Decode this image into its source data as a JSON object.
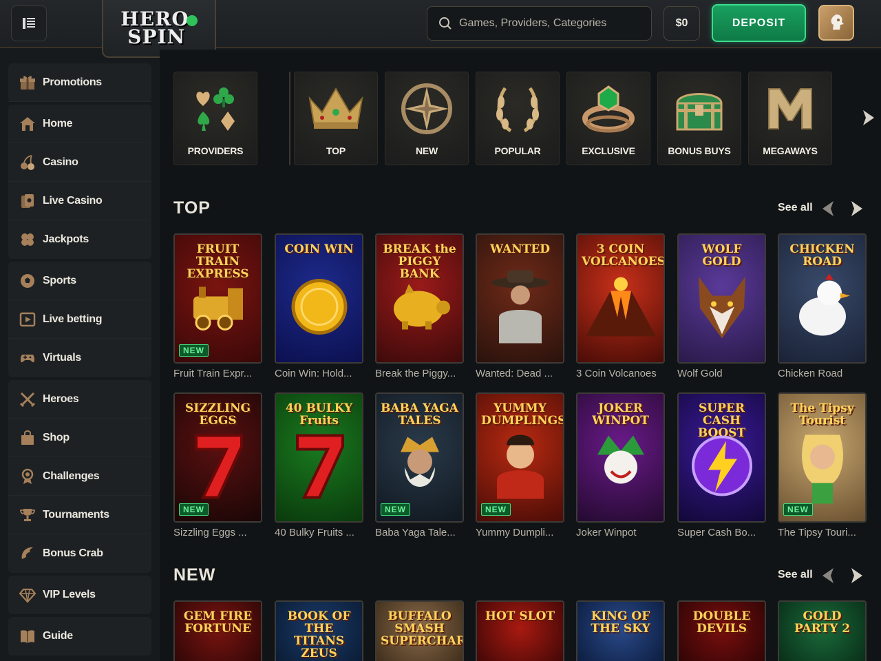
{
  "brand": {
    "logo_line1": "HERO",
    "logo_line2": "SPIN"
  },
  "header": {
    "search_placeholder": "Games, Providers, Categories",
    "balance": "$0",
    "deposit_label": "DEPOSIT"
  },
  "sidebar": {
    "groups": [
      [
        {
          "label": "Promotions",
          "icon": "gift-icon"
        }
      ],
      [
        {
          "label": "Home",
          "icon": "home-icon"
        },
        {
          "label": "Casino",
          "icon": "cherries-icon"
        },
        {
          "label": "Live Casino",
          "icon": "cards-icon"
        },
        {
          "label": "Jackpots",
          "icon": "clover-icon"
        }
      ],
      [
        {
          "label": "Sports",
          "icon": "soccer-ball-icon"
        },
        {
          "label": "Live betting",
          "icon": "live-play-icon"
        },
        {
          "label": "Virtuals",
          "icon": "gamepad-icon"
        }
      ],
      [
        {
          "label": "Heroes",
          "icon": "swords-icon"
        },
        {
          "label": "Shop",
          "icon": "bag-icon"
        },
        {
          "label": "Challenges",
          "icon": "medal-icon"
        },
        {
          "label": "Tournaments",
          "icon": "trophy-icon"
        },
        {
          "label": "Bonus Crab",
          "icon": "crab-claw-icon"
        }
      ],
      [
        {
          "label": "VIP Levels",
          "icon": "diamond-icon"
        }
      ],
      [
        {
          "label": "Guide",
          "icon": "book-icon"
        }
      ]
    ]
  },
  "categories": [
    {
      "label": "PROVIDERS",
      "icon": "card-suits-icon"
    },
    {
      "label": "TOP",
      "icon": "crown-icon"
    },
    {
      "label": "NEW",
      "icon": "compass-star-icon"
    },
    {
      "label": "POPULAR",
      "icon": "laurel-wreath-icon"
    },
    {
      "label": "EXCLUSIVE",
      "icon": "emerald-ring-icon"
    },
    {
      "label": "BONUS BUYS",
      "icon": "treasure-chest-icon"
    },
    {
      "label": "MEGAWAYS",
      "icon": "megaways-m-icon"
    }
  ],
  "sections": {
    "top": {
      "title": "TOP",
      "see_all": "See all",
      "rows": [
        [
          {
            "name": "Fruit Train Expr...",
            "art_title": "FRUIT TRAIN EXPRESS",
            "new": "NEW",
            "colors": [
              "#7a1410",
              "#3a0808"
            ],
            "emblem": "locomotive-icon"
          },
          {
            "name": "Coin Win: Hold...",
            "art_title": "COIN WIN",
            "new": "",
            "colors": [
              "#1d2a8a",
              "#0c1050"
            ],
            "emblem": "gold-coin-icon"
          },
          {
            "name": "Break the Piggy...",
            "art_title": "BREAK the PIGGY BANK",
            "new": "",
            "colors": [
              "#9a1a1a",
              "#3e0a0a"
            ],
            "emblem": "piggy-bank-icon"
          },
          {
            "name": "Wanted: Dead ...",
            "art_title": "WANTED",
            "new": "",
            "colors": [
              "#6e2a18",
              "#2a120c"
            ],
            "emblem": "cowboy-icon"
          },
          {
            "name": "3 Coin Volcanoes",
            "art_title": "3 COIN VOLCANOES",
            "new": "",
            "colors": [
              "#c8301a",
              "#4a0c06"
            ],
            "emblem": "volcano-icon"
          },
          {
            "name": "Wolf Gold",
            "art_title": "WOLF GOLD",
            "new": "",
            "colors": [
              "#5a3a9a",
              "#2a1a4a"
            ],
            "emblem": "wolf-icon"
          },
          {
            "name": "Chicken Road",
            "art_title": "CHICKEN ROAD",
            "new": "",
            "colors": [
              "#384a6a",
              "#1a2236"
            ],
            "emblem": "chicken-icon"
          }
        ],
        [
          {
            "name": "Sizzling Eggs ...",
            "art_title": "SIZZLING EGGS",
            "new": "NEW",
            "colors": [
              "#5a1010",
              "#1a0606"
            ],
            "emblem": "lucky-seven-icon"
          },
          {
            "name": "40 Bulky Fruits ...",
            "art_title": "40 BULKY Fruits",
            "new": "",
            "colors": [
              "#1a7a20",
              "#0a3a0c"
            ],
            "emblem": "lucky-seven-icon"
          },
          {
            "name": "Baba Yaga Tale...",
            "art_title": "BABA YAGA TALES",
            "new": "NEW",
            "colors": [
              "#2a3a4a",
              "#101820"
            ],
            "emblem": "old-king-icon"
          },
          {
            "name": "Yummy Dumpli...",
            "art_title": "YUMMY DUMPLINGS",
            "new": "NEW",
            "colors": [
              "#b82a12",
              "#4a0c06"
            ],
            "emblem": "chef-icon"
          },
          {
            "name": "Joker Winpot",
            "art_title": "JOKER WINPOT",
            "new": "",
            "colors": [
              "#6a1a8a",
              "#240a30"
            ],
            "emblem": "joker-icon"
          },
          {
            "name": "Super Cash Bo...",
            "art_title": "SUPER CASH BOOST",
            "new": "",
            "colors": [
              "#3a1a9a",
              "#120838"
            ],
            "emblem": "lightning-icon"
          },
          {
            "name": "The Tipsy Touri...",
            "art_title": "The Tipsy Tourist",
            "new": "NEW",
            "colors": [
              "#c8a870",
              "#6a5030"
            ],
            "emblem": "tourist-icon"
          }
        ]
      ]
    },
    "new": {
      "title": "NEW",
      "see_all": "See all",
      "row": [
        {
          "art_title": "GEM FIRE FORTUNE",
          "colors": [
            "#7a1410",
            "#2a0606"
          ]
        },
        {
          "art_title": "BOOK OF THE TITANS ZEUS",
          "colors": [
            "#1a3a6a",
            "#0a1a30"
          ]
        },
        {
          "art_title": "BUFFALO SMASH SUPERCHARGED",
          "colors": [
            "#8a6a4a",
            "#3a2a18"
          ]
        },
        {
          "art_title": "HOT SLOT",
          "colors": [
            "#a81a10",
            "#3a0606"
          ]
        },
        {
          "art_title": "KING OF THE SKY",
          "colors": [
            "#2a4a8a",
            "#0a1a3a"
          ]
        },
        {
          "art_title": "DOUBLE DEVILS",
          "colors": [
            "#7a0e0e",
            "#2a0404"
          ]
        },
        {
          "art_title": "GOLD PARTY 2",
          "colors": [
            "#1a6a3a",
            "#082a16"
          ]
        }
      ]
    }
  }
}
